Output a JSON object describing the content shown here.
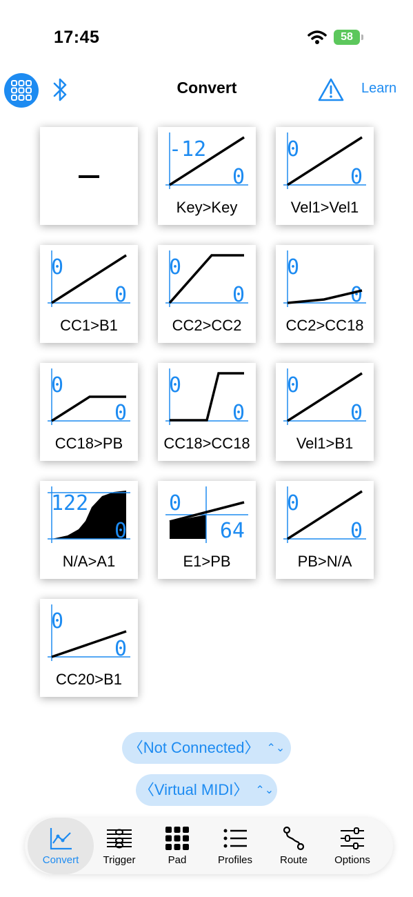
{
  "status_bar": {
    "time": "17:45",
    "battery_level": "58"
  },
  "nav": {
    "title": "Convert",
    "learn_label": "Learn"
  },
  "colors": {
    "accent": "#1d8bf1",
    "pill_bg": "#cfe6fb",
    "battery": "#5cc75c"
  },
  "tiles": [
    {
      "label": "",
      "mode": "empty"
    },
    {
      "label": "Key>Key",
      "axis_top": "-12",
      "axis_bottom": "0"
    },
    {
      "label": "Vel1>Vel1",
      "axis_top": "0",
      "axis_bottom": "0"
    },
    {
      "label": "CC1>B1",
      "axis_top": "0",
      "axis_bottom": "0"
    },
    {
      "label": "CC2>CC2",
      "axis_top": "0",
      "axis_bottom": "0"
    },
    {
      "label": "CC2>CC18",
      "axis_top": "0",
      "axis_bottom": "0"
    },
    {
      "label": "CC18>PB",
      "axis_top": "0",
      "axis_bottom": "0"
    },
    {
      "label": "CC18>CC18",
      "axis_top": "0",
      "axis_bottom": "0"
    },
    {
      "label": "Vel1>B1",
      "axis_top": "0",
      "axis_bottom": "0"
    },
    {
      "label": "N/A>A1",
      "axis_top": "122",
      "axis_bottom": "0"
    },
    {
      "label": "E1>PB",
      "axis_top": "0",
      "axis_bottom": "64"
    },
    {
      "label": "PB>N/A",
      "axis_top": "0",
      "axis_bottom": "0"
    },
    {
      "label": "CC20>B1",
      "axis_top": "0",
      "axis_bottom": "0"
    }
  ],
  "selectors": {
    "connection": "〈Not Connected〉",
    "port": "〈Virtual MIDI〉",
    "chevron": "⌃⌄"
  },
  "tabs": [
    {
      "label": "Convert",
      "icon": "chart-icon",
      "active": true
    },
    {
      "label": "Trigger",
      "icon": "staff-icon",
      "active": false
    },
    {
      "label": "Pad",
      "icon": "pad-grid-icon",
      "active": false
    },
    {
      "label": "Profiles",
      "icon": "list-icon",
      "active": false
    },
    {
      "label": "Route",
      "icon": "route-icon",
      "active": false
    },
    {
      "label": "Options",
      "icon": "sliders-icon",
      "active": false
    }
  ]
}
